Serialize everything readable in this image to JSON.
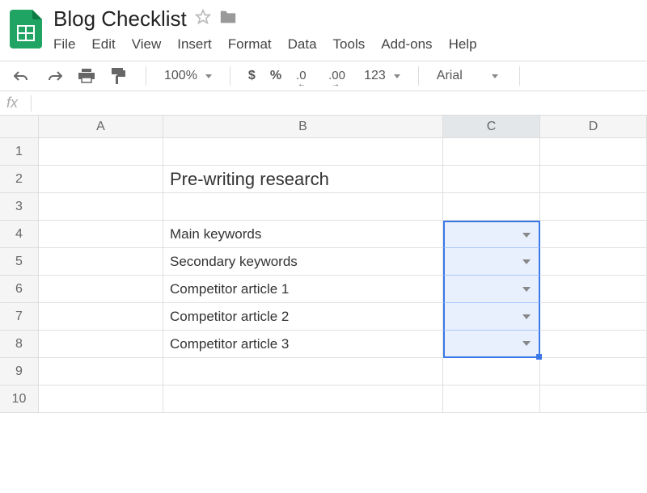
{
  "doc_title": "Blog Checklist",
  "menu": [
    "File",
    "Edit",
    "View",
    "Insert",
    "Format",
    "Data",
    "Tools",
    "Add-ons",
    "Help"
  ],
  "toolbar": {
    "zoom": "100%",
    "currency": "$",
    "percent": "%",
    "dec_dec": ".0",
    "inc_dec": ".00",
    "format_num": "123",
    "font": "Arial"
  },
  "fx_label": "fx",
  "columns": [
    "A",
    "B",
    "C",
    "D"
  ],
  "rows": [
    "1",
    "2",
    "3",
    "4",
    "5",
    "6",
    "7",
    "8",
    "9",
    "10"
  ],
  "cells": {
    "B2": "Pre-writing research",
    "B4": "Main keywords",
    "B5": "Secondary keywords",
    "B6": "Competitor article 1",
    "B7": "Competitor article 2",
    "B8": "Competitor article 3"
  }
}
